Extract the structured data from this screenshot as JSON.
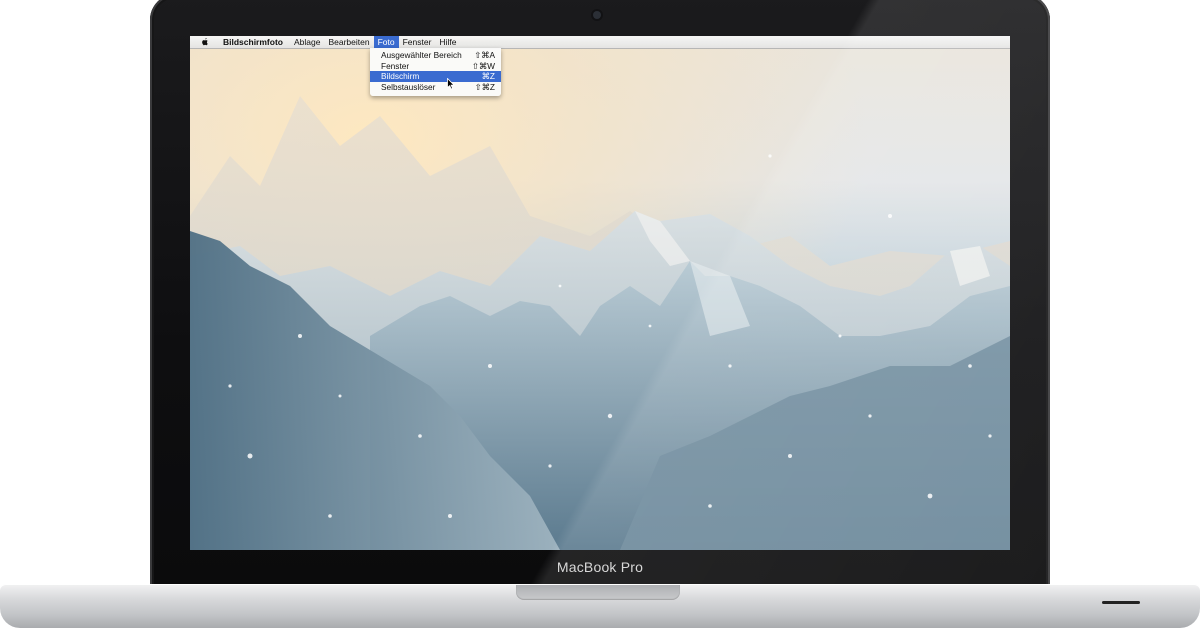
{
  "menubar": {
    "app_name": "Bildschirmfoto",
    "items": [
      "Ablage",
      "Bearbeiten",
      "Foto",
      "Fenster",
      "Hilfe"
    ],
    "active_item": "Foto"
  },
  "dropdown": {
    "items": [
      {
        "label": "Ausgewählter Bereich",
        "shortcut": "⇧⌘A"
      },
      {
        "label": "Fenster",
        "shortcut": "⇧⌘W"
      },
      {
        "label": "Bildschirm",
        "shortcut": "⌘Z"
      },
      {
        "label": "Selbstauslöser",
        "shortcut": "⇧⌘Z"
      }
    ],
    "selected_index": 2
  },
  "device": {
    "brand_label": "MacBook Pro"
  },
  "icons": {
    "apple": "apple-icon",
    "cursor": "cursor-icon",
    "camera": "camera-icon"
  }
}
